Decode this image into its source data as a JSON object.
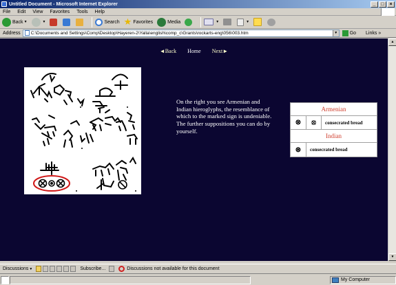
{
  "window": {
    "title": "Untitled Document - Microsoft Internet Explorer",
    "minimize": "_",
    "maximize": "□",
    "close": "×"
  },
  "menu": [
    "File",
    "Edit",
    "View",
    "Favorites",
    "Tools",
    "Help"
  ],
  "toolbar": {
    "back_label": "Back",
    "search_label": "Search",
    "favorites_label": "Favorites",
    "media_label": "Media"
  },
  "address": {
    "label": "Address",
    "url": "C:\\Documents and Settings\\Comp\\Desktop\\Hayeren-2\\Yalla\\english\\comp_c\\Grants\\rockarts-eng\\056\\003.htm",
    "go_label": "Go",
    "links_label": "Links"
  },
  "page": {
    "nav": {
      "back": "◄Back",
      "home": "Home",
      "next": "Next►"
    },
    "blurb": "On the right you see Armenian and Indian hieroglyphs, the resemblance of which to the marked sign is undeniable. The further suppositions you can do by yourself.",
    "legend": {
      "armenian_title": "Armenian",
      "armenian_sym1": "⊗",
      "armenian_sym2": "⦻",
      "armenian_text": "consecrated bread",
      "indian_title": "Indian",
      "indian_sym": "⊛",
      "indian_text": "consecrated bread"
    }
  },
  "linksbar": {
    "discussions": "Discussions",
    "subscribe": "Subscribe...",
    "notice": "Discussions not available for this document"
  },
  "status": {
    "zone": "My Computer"
  }
}
